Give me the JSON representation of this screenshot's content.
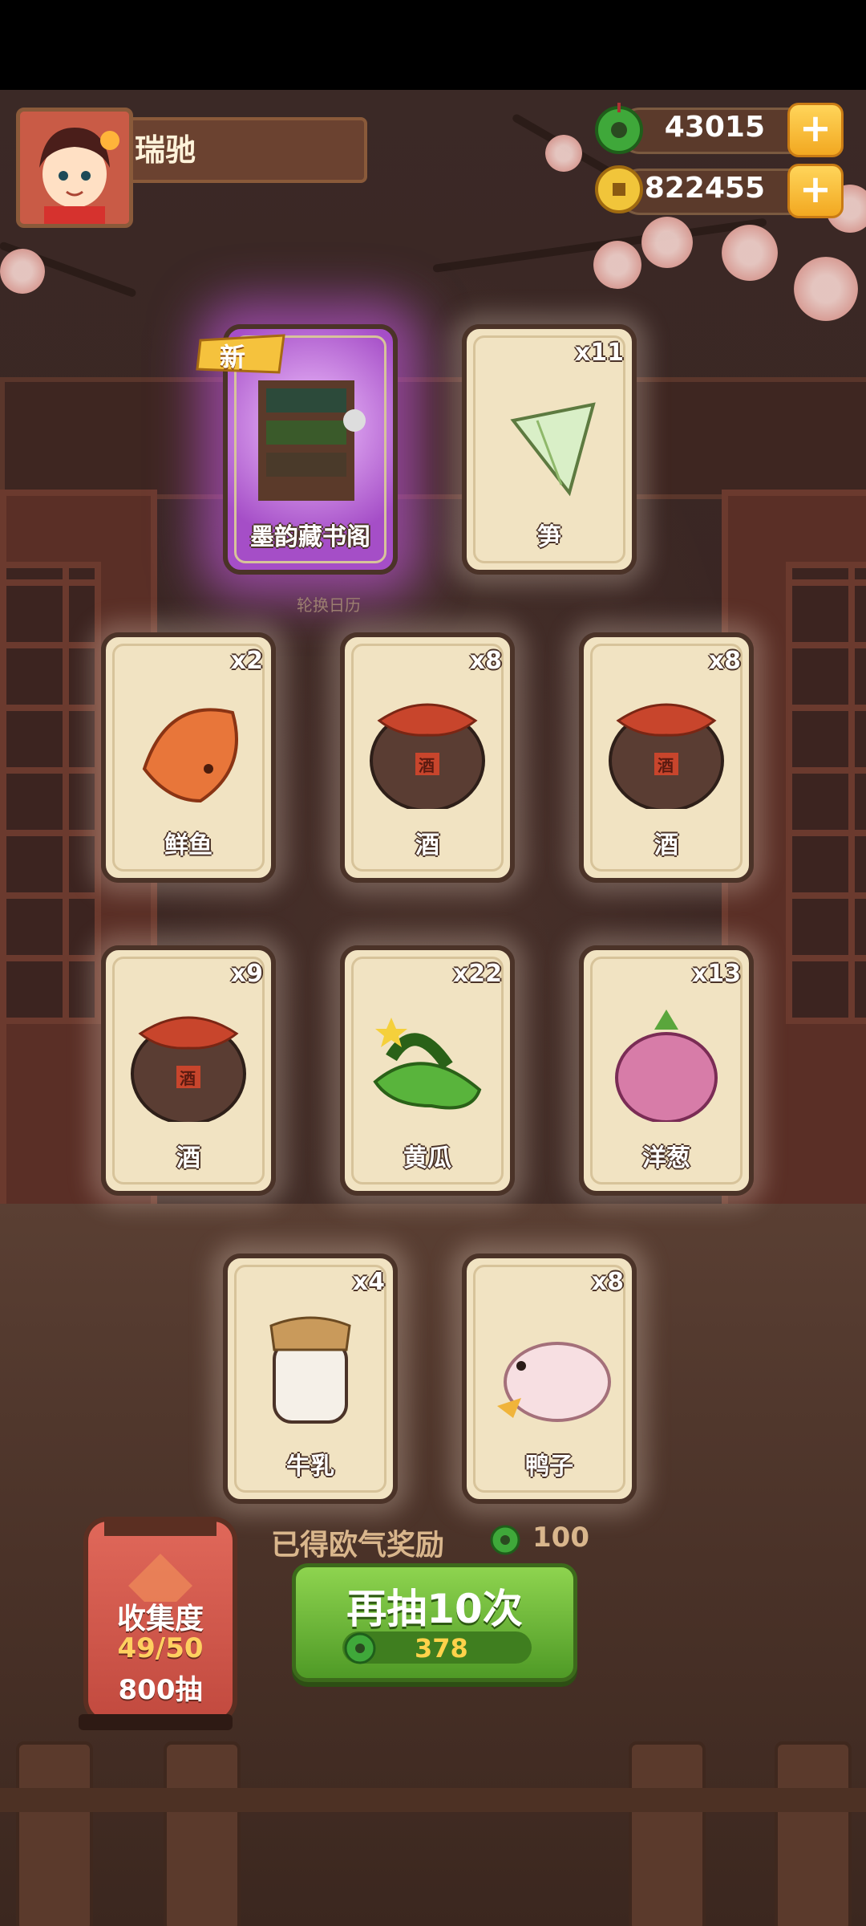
{
  "player": {
    "name": "瑞驰"
  },
  "currencies": {
    "jade": {
      "value": "43015",
      "icon": "jade-coin-icon"
    },
    "copper": {
      "value": "822455",
      "icon": "copper-coin-icon"
    },
    "plus_label": "+"
  },
  "draw_results": {
    "new_badge": "新",
    "caption": "轮换日历",
    "cards": [
      {
        "label": "墨韵藏书阁",
        "count": "",
        "icon": "bookshelf-icon",
        "is_new": true
      },
      {
        "label": "笋",
        "count": "x11",
        "icon": "bamboo-shoot-icon"
      },
      {
        "label": "鲜鱼",
        "count": "x2",
        "icon": "fish-icon"
      },
      {
        "label": "酒",
        "count": "x8",
        "icon": "wine-jar-icon"
      },
      {
        "label": "酒",
        "count": "x8",
        "icon": "wine-jar-icon"
      },
      {
        "label": "酒",
        "count": "x9",
        "icon": "wine-jar-icon"
      },
      {
        "label": "黄瓜",
        "count": "x22",
        "icon": "cucumber-icon"
      },
      {
        "label": "洋葱",
        "count": "x13",
        "icon": "onion-icon"
      },
      {
        "label": "牛乳",
        "count": "x4",
        "icon": "milk-jar-icon"
      },
      {
        "label": "鸭子",
        "count": "x8",
        "icon": "duck-icon"
      }
    ],
    "jar_text": "酒"
  },
  "reward": {
    "text": "已得欧气奖励",
    "value": "100"
  },
  "collection": {
    "title": "收集度",
    "progress": "49/50",
    "draws": "800抽"
  },
  "draw_again": {
    "label": "再抽10次",
    "cost": "378"
  }
}
